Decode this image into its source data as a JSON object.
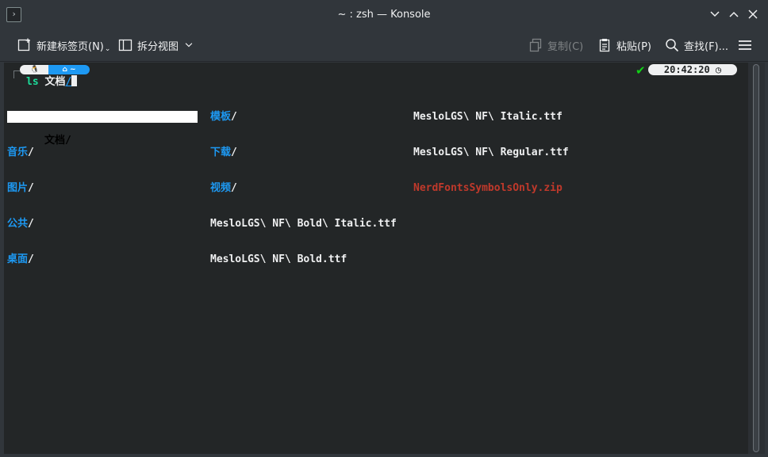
{
  "window": {
    "title": "~ : zsh — Konsole"
  },
  "icons": {
    "app": "terminal-app-icon",
    "minimize": "chevron-down-icon",
    "maximize": "chevron-up-icon",
    "close": "close-icon"
  },
  "toolbar": {
    "new_tab": "新建标签页(N)",
    "split_view": "拆分视图",
    "copy": "复制(C)",
    "paste": "粘贴(P)",
    "find": "查找(F)..."
  },
  "prompt": {
    "segment_left_icon": "🐧",
    "segment_home": "⌂ ~",
    "command": "ls",
    "argument": "文档",
    "argument_suffix": "/",
    "status_check": "✔",
    "time": "20:42:20 ◷"
  },
  "listing": {
    "col1": [
      {
        "name": "文档",
        "suffix": "/",
        "type": "dir"
      },
      {
        "name": "音乐",
        "suffix": "/",
        "type": "dir"
      },
      {
        "name": "图片",
        "suffix": "/",
        "type": "dir"
      },
      {
        "name": "公共",
        "suffix": "/",
        "type": "dir"
      },
      {
        "name": "桌面",
        "suffix": "/",
        "type": "dir"
      }
    ],
    "col2": [
      {
        "name": "模板",
        "suffix": "/",
        "type": "dir"
      },
      {
        "name": "下载",
        "suffix": "/",
        "type": "dir"
      },
      {
        "name": "视频",
        "suffix": "/",
        "type": "dir"
      },
      {
        "name": "MesloLGS\\ NF\\ Bold\\ Italic.ttf",
        "suffix": "",
        "type": "file"
      },
      {
        "name": "MesloLGS\\ NF\\ Bold.ttf",
        "suffix": "",
        "type": "file"
      }
    ],
    "col3": [
      {
        "name": "MesloLGS\\ NF\\ Italic.ttf",
        "suffix": "",
        "type": "file"
      },
      {
        "name": "MesloLGS\\ NF\\ Regular.ttf",
        "suffix": "",
        "type": "file"
      },
      {
        "name": "NerdFontsSymbolsOnly.zip",
        "suffix": "",
        "type": "zip"
      }
    ]
  },
  "colors": {
    "accent": "#1d99f3",
    "terminal_bg": "#232627",
    "command": "#1cdc9a",
    "archive": "#c0392b",
    "success": "#11d116"
  }
}
